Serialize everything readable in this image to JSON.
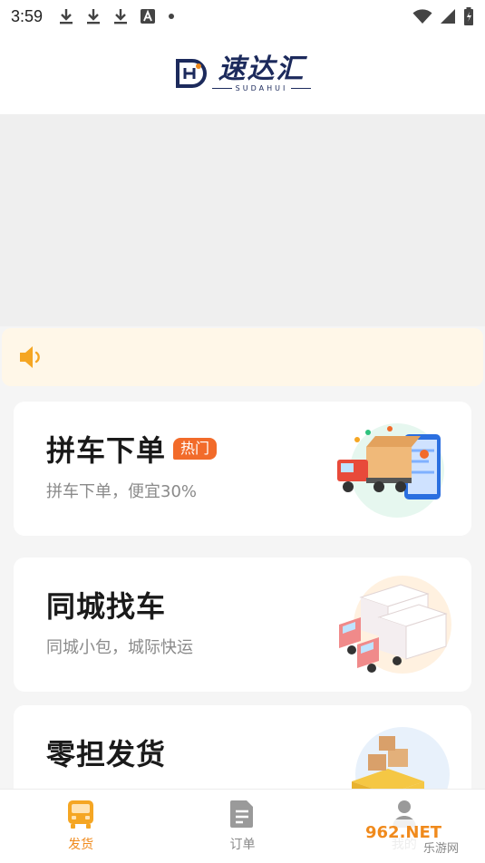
{
  "status_bar": {
    "time": "3:59",
    "icons_left": [
      "download-icon",
      "download-icon",
      "download-icon",
      "a-square-icon",
      "dot-icon"
    ],
    "icons_right": [
      "wifi-icon",
      "signal-icon",
      "battery-icon"
    ]
  },
  "header": {
    "logo_text": "速达汇",
    "logo_sub": "SUDAHUI"
  },
  "notice": {
    "icon": "speaker-icon",
    "text": ""
  },
  "cards": [
    {
      "title": "拼车下单",
      "badge": "热门",
      "subtitle": "拼车下单，便宜30%",
      "illustration": "truck-map-illustration"
    },
    {
      "title": "同城找车",
      "subtitle": "同城小包，城际快运",
      "illustration": "two-trucks-illustration"
    },
    {
      "title": "零担发货",
      "subtitle": "",
      "illustration": "loading-truck-illustration"
    }
  ],
  "tabbar": {
    "tabs": [
      {
        "label": "发货",
        "icon": "truck-icon",
        "active": true
      },
      {
        "label": "订单",
        "icon": "document-icon",
        "active": false
      },
      {
        "label": "我的",
        "icon": "person-icon",
        "active": false
      }
    ]
  },
  "watermark": {
    "text": "962.NET",
    "sub": "乐游网"
  },
  "colors": {
    "accent": "#f08a1c",
    "badge": "#f26b2a",
    "logo": "#1c2a5c",
    "notice_bg": "#fff7e8"
  }
}
